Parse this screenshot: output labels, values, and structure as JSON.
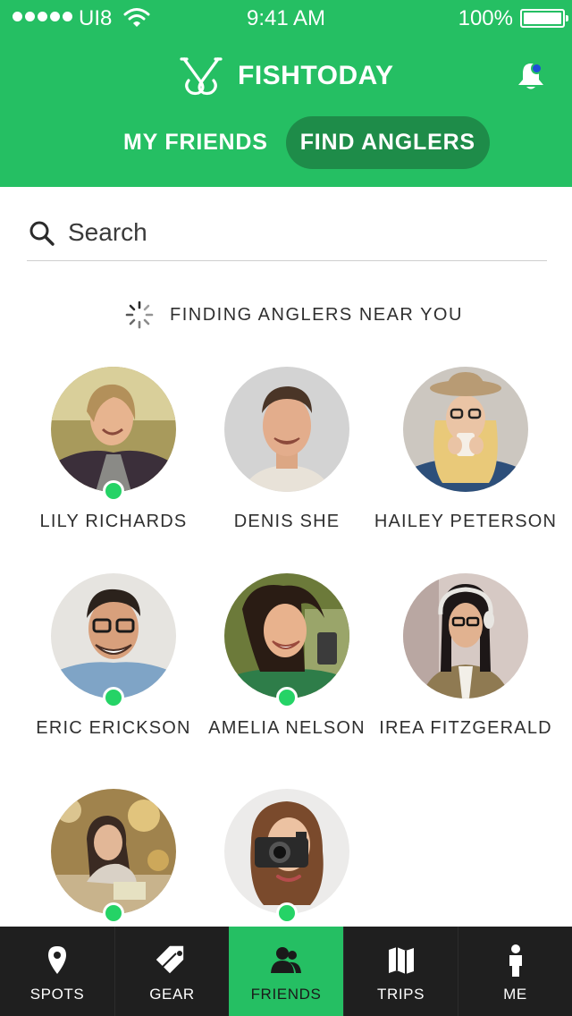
{
  "status_bar": {
    "carrier": "UI8",
    "time": "9:41 AM",
    "battery": "100%"
  },
  "header": {
    "app_name": "FISHTODAY",
    "tabs": [
      {
        "label": "MY FRIENDS",
        "active": false
      },
      {
        "label": "FIND ANGLERS",
        "active": true
      }
    ]
  },
  "search": {
    "placeholder": "Search"
  },
  "status_text": "FINDING ANGLERS NEAR YOU",
  "anglers": [
    {
      "name": "LILY RICHARDS",
      "online": true
    },
    {
      "name": "DENIS SHE",
      "online": false
    },
    {
      "name": "HAILEY PETERSON",
      "online": false
    },
    {
      "name": "ERIC ERICKSON",
      "online": true
    },
    {
      "name": "AMELIA NELSON",
      "online": true
    },
    {
      "name": "IREA FITZGERALD",
      "online": false
    },
    {
      "name": "",
      "online": true
    },
    {
      "name": "",
      "online": true
    }
  ],
  "nav": [
    {
      "label": "SPOTS",
      "icon": "map-pin-icon",
      "active": false
    },
    {
      "label": "GEAR",
      "icon": "tag-icon",
      "active": false
    },
    {
      "label": "FRIENDS",
      "icon": "friends-icon",
      "active": true
    },
    {
      "label": "TRIPS",
      "icon": "map-icon",
      "active": false
    },
    {
      "label": "ME",
      "icon": "person-icon",
      "active": false
    }
  ],
  "colors": {
    "brand_green": "#25bf63",
    "active_pill": "#1e8c49",
    "online_dot": "#25d366",
    "nav_bg": "#1f1f1f",
    "notification_dot": "#1e4ed8"
  }
}
